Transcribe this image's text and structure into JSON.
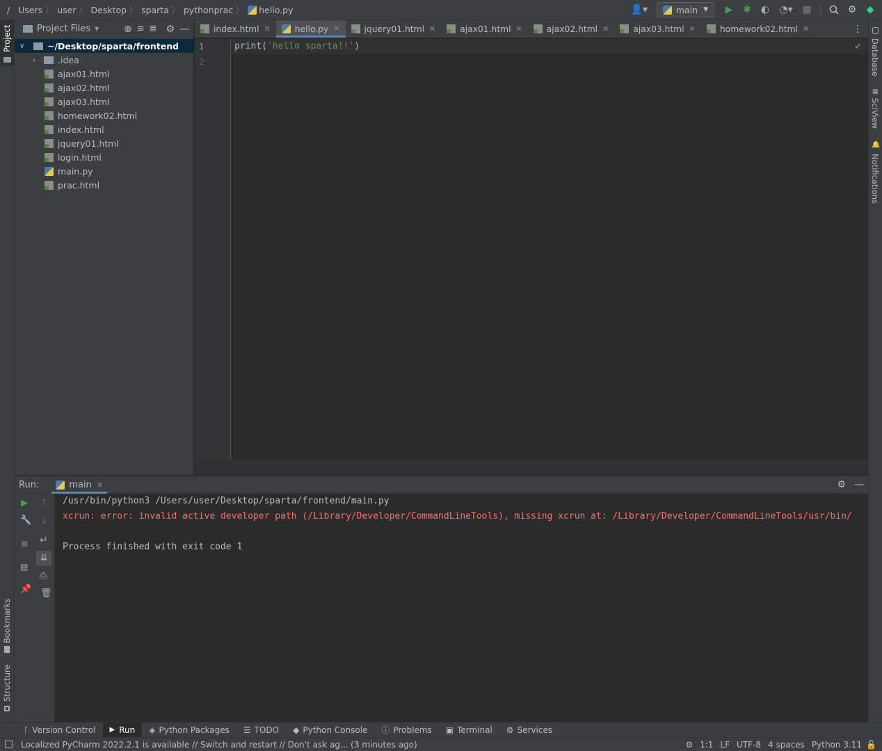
{
  "navbar": {
    "root": "/",
    "breadcrumbs": [
      "Users",
      "user",
      "Desktop",
      "sparta",
      "pythonprac"
    ],
    "file": "hello.py",
    "run_config": "main"
  },
  "left_stripe": {
    "project": "Project",
    "bookmarks": "Bookmarks",
    "structure": "Structure"
  },
  "right_stripe": {
    "database": "Database",
    "sciview": "SciView",
    "notifications": "Notifications"
  },
  "project_panel": {
    "title": "Project Files",
    "root": "~/Desktop/sparta/frontend",
    "items": [
      {
        "name": ".idea",
        "type": "folder"
      },
      {
        "name": "ajax01.html",
        "type": "html"
      },
      {
        "name": "ajax02.html",
        "type": "html"
      },
      {
        "name": "ajax03.html",
        "type": "html"
      },
      {
        "name": "homework02.html",
        "type": "html"
      },
      {
        "name": "index.html",
        "type": "html"
      },
      {
        "name": "jquery01.html",
        "type": "html"
      },
      {
        "name": "login.html",
        "type": "html"
      },
      {
        "name": "main.py",
        "type": "py"
      },
      {
        "name": "prac.html",
        "type": "html"
      }
    ]
  },
  "tabs": [
    {
      "label": "index.html",
      "type": "html"
    },
    {
      "label": "hello.py",
      "type": "py",
      "active": true
    },
    {
      "label": "jquery01.html",
      "type": "html"
    },
    {
      "label": "ajax01.html",
      "type": "html"
    },
    {
      "label": "ajax02.html",
      "type": "html"
    },
    {
      "label": "ajax03.html",
      "type": "html"
    },
    {
      "label": "homework02.html",
      "type": "html"
    }
  ],
  "editor": {
    "line_numbers": [
      "1",
      "2"
    ],
    "code_fn": "print(",
    "code_str": "'hello sparta!!'",
    "code_end": ")"
  },
  "run": {
    "label": "Run:",
    "config": "main",
    "command": "/usr/bin/python3 /Users/user/Desktop/sparta/frontend/main.py",
    "error": "xcrun: error: invalid active developer path (/Library/Developer/CommandLineTools), missing xcrun at: /Library/Developer/CommandLineTools/usr/bin/",
    "exit": "Process finished with exit code 1"
  },
  "bottom_tools": {
    "version_control": "Version Control",
    "run": "Run",
    "python_packages": "Python Packages",
    "todo": "TODO",
    "python_console": "Python Console",
    "problems": "Problems",
    "terminal": "Terminal",
    "services": "Services"
  },
  "status": {
    "message": "Localized PyCharm 2022.2.1 is available // Switch and restart // Don't ask ag... (3 minutes ago)",
    "position": "1:1",
    "line_sep": "LF",
    "encoding": "UTF-8",
    "indent": "4 spaces",
    "interpreter": "Python 3.11"
  },
  "colors": {
    "accent": "#4a88c7",
    "string": "#6a8759",
    "error": "#ff6b68",
    "run_green": "#499c54"
  }
}
